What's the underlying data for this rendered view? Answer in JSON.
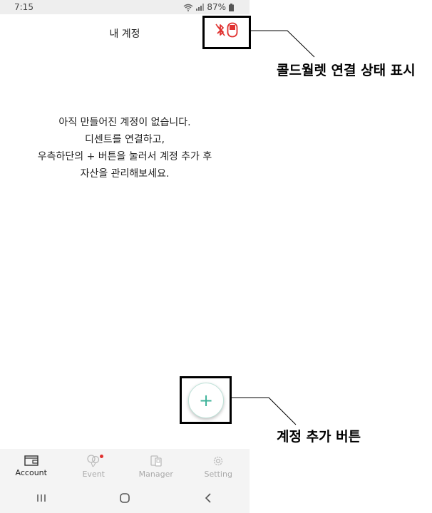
{
  "status_bar": {
    "time": "7:15",
    "battery": "87%"
  },
  "header": {
    "title": "내 계정"
  },
  "empty_state": {
    "lines": [
      "아직 만들어진 계정이 없습니다.",
      "디센트를 연결하고,",
      "우측하단의 + 버튼을 눌러서 계정 추가 후",
      "자산을 관리해보세요."
    ]
  },
  "fab": {
    "symbol": "+"
  },
  "bottom_nav": {
    "items": [
      {
        "label": "Account",
        "icon": "wallet-icon",
        "active": true
      },
      {
        "label": "Event",
        "icon": "balloons-icon",
        "active": false
      },
      {
        "label": "Manager",
        "icon": "manager-icon",
        "active": false
      },
      {
        "label": "Setting",
        "icon": "gear-icon",
        "active": false
      }
    ]
  },
  "annotations": {
    "cold_wallet_status": "콜드월렛 연결 상태 표시",
    "add_account_button": "계정 추가 버튼"
  },
  "colors": {
    "accent_green": "#3fb39a",
    "disconnected_red": "#e0312f"
  }
}
